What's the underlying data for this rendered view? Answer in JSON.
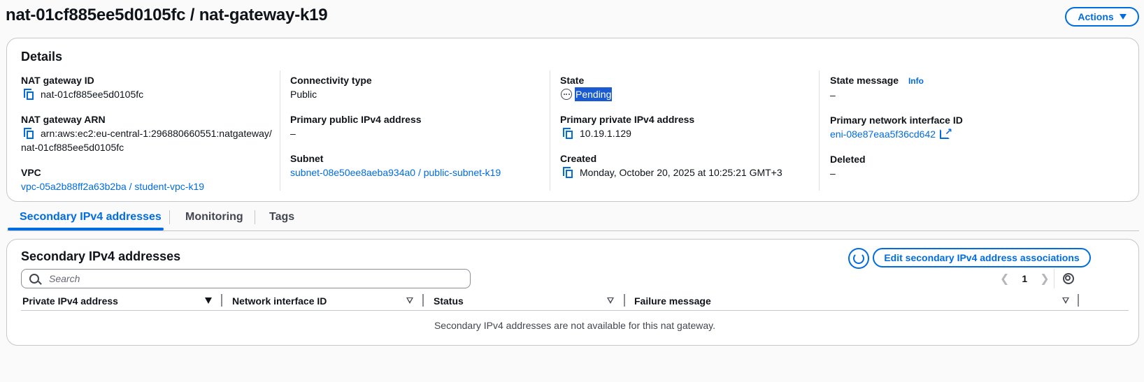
{
  "page": {
    "title": "nat-01cf885ee5d0105fc / nat-gateway-k19",
    "actions_label": "Actions"
  },
  "details": {
    "heading": "Details",
    "nat_gateway_id_label": "NAT gateway ID",
    "nat_gateway_id": "nat-01cf885ee5d0105fc",
    "nat_gateway_arn_label": "NAT gateway ARN",
    "nat_gateway_arn_line1": "arn:aws:ec2:eu-central-1:296880660551:natgateway/",
    "nat_gateway_arn_line2": "nat-01cf885ee5d0105fc",
    "vpc_label": "VPC",
    "vpc": "vpc-05a2b88ff2a63b2ba / student-vpc-k19",
    "connectivity_type_label": "Connectivity type",
    "connectivity_type": "Public",
    "primary_public_ipv4_label": "Primary public IPv4 address",
    "primary_public_ipv4": "–",
    "subnet_label": "Subnet",
    "subnet": "subnet-08e50ee8aeba934a0 / public-subnet-k19",
    "state_label": "State",
    "state": "Pending",
    "primary_private_ipv4_label": "Primary private IPv4 address",
    "primary_private_ipv4": "10.19.1.129",
    "created_label": "Created",
    "created": "Monday, October 20, 2025 at 10:25:21 GMT+3",
    "state_message_label": "State message",
    "info_label": "Info",
    "state_message": "–",
    "primary_eni_label": "Primary network interface ID",
    "primary_eni": "eni-08e87eaa5f36cd642",
    "deleted_label": "Deleted",
    "deleted": "–"
  },
  "tabs": [
    {
      "label": "Secondary IPv4 addresses",
      "active": true
    },
    {
      "label": "Monitoring",
      "active": false
    },
    {
      "label": "Tags",
      "active": false
    }
  ],
  "secondary": {
    "heading": "Secondary IPv4 addresses",
    "edit_label": "Edit secondary IPv4 address associations",
    "search_placeholder": "Search",
    "page_number": "1",
    "columns": [
      "Private IPv4 address",
      "Network interface ID",
      "Status",
      "Failure message"
    ],
    "empty_message": "Secondary IPv4 addresses are not available for this nat gateway."
  },
  "icons": {
    "copy": "copy-icon",
    "pending": "pending-status-icon",
    "external": "external-link-icon",
    "refresh": "refresh-icon",
    "search": "search-icon",
    "settings": "gear-icon",
    "chevron_left": "chevron-left-icon",
    "chevron_right": "chevron-right-icon"
  },
  "colors": {
    "link": "#006ce0",
    "text": "#0f141a",
    "border": "#c6c6cd",
    "highlight": "#1a5bd1"
  }
}
